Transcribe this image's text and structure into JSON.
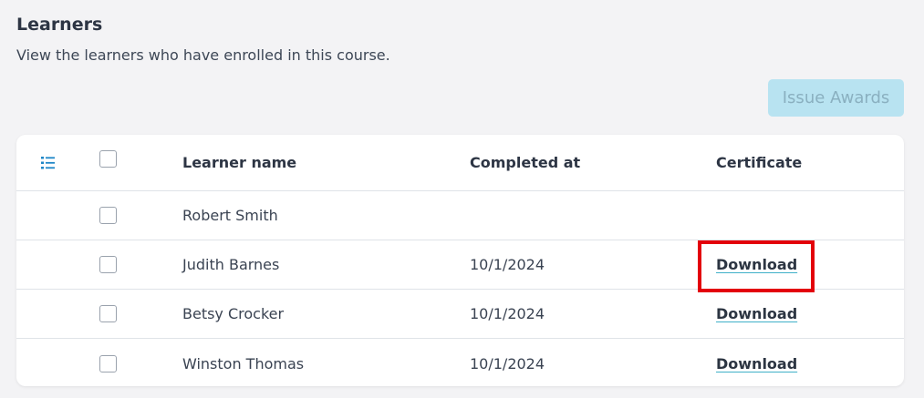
{
  "section": {
    "title": "Learners",
    "subtitle": "View the learners who have enrolled in this course."
  },
  "actions": {
    "issue_awards_label": "Issue Awards"
  },
  "table": {
    "columns": {
      "name": "Learner name",
      "completed": "Completed at",
      "certificate": "Certificate"
    },
    "rows": [
      {
        "name": "Robert Smith",
        "completed": "",
        "certificate": ""
      },
      {
        "name": "Judith Barnes",
        "completed": "10/1/2024",
        "certificate": "Download"
      },
      {
        "name": "Betsy Crocker",
        "completed": "10/1/2024",
        "certificate": "Download"
      },
      {
        "name": "Winston Thomas",
        "completed": "10/1/2024",
        "certificate": "Download"
      }
    ]
  },
  "icons": {
    "column_toggle": "list-settings-icon"
  },
  "colors": {
    "accent": "#3fb0c8",
    "button_disabled_bg": "#b8e3f1",
    "highlight": "#e3000b"
  }
}
